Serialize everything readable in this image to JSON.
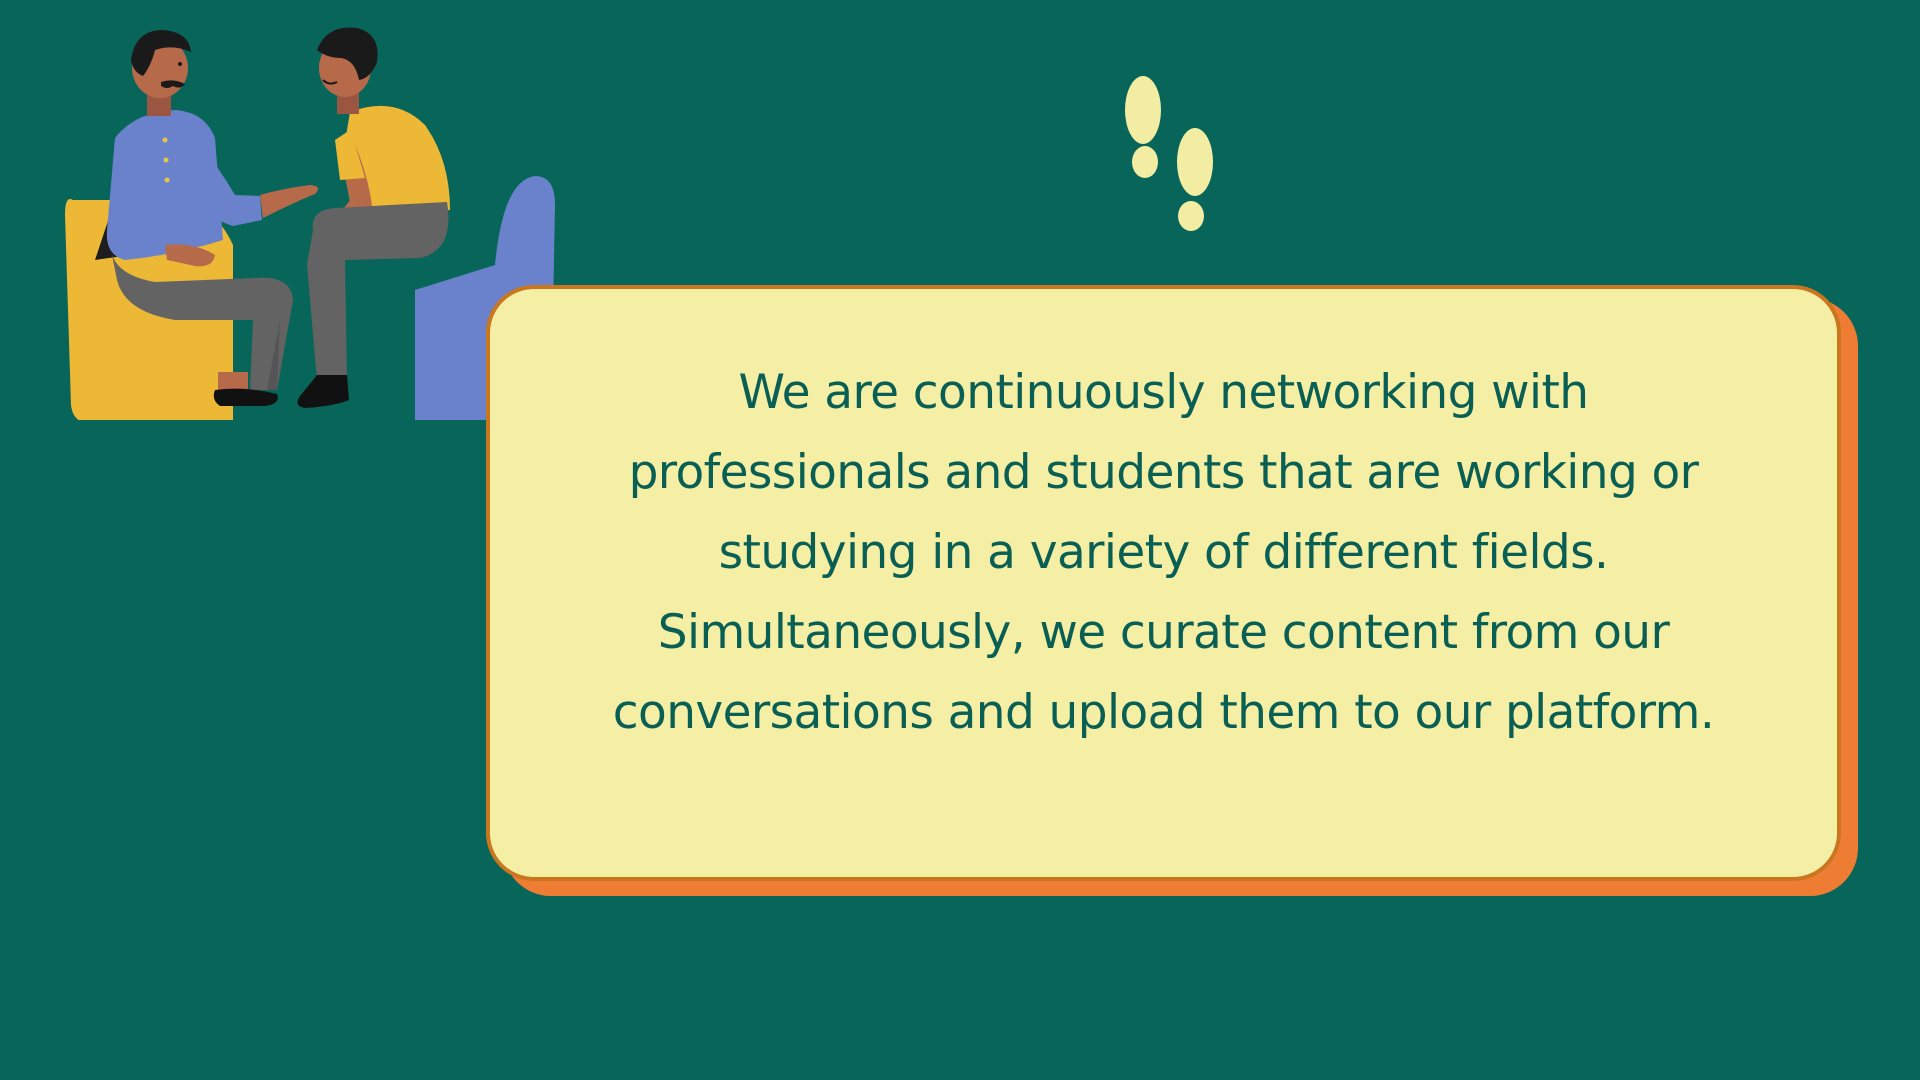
{
  "colors": {
    "background": "#08655a",
    "card_fill": "#f5efa5",
    "card_border": "#c9761f",
    "card_shadow": "#ee7d33",
    "text": "#0a5f54",
    "footprint": "#f3eda3"
  },
  "illustration": {
    "icon": "two-people-conversation-icon"
  },
  "decoration": {
    "icon": "footprints-icon"
  },
  "card": {
    "lines": [
      "We are continuously networking with",
      "professionals and students that are working or",
      "studying in a variety of different fields.",
      "Simultaneously, we curate content from our",
      "conversations and upload them to our platform."
    ]
  }
}
